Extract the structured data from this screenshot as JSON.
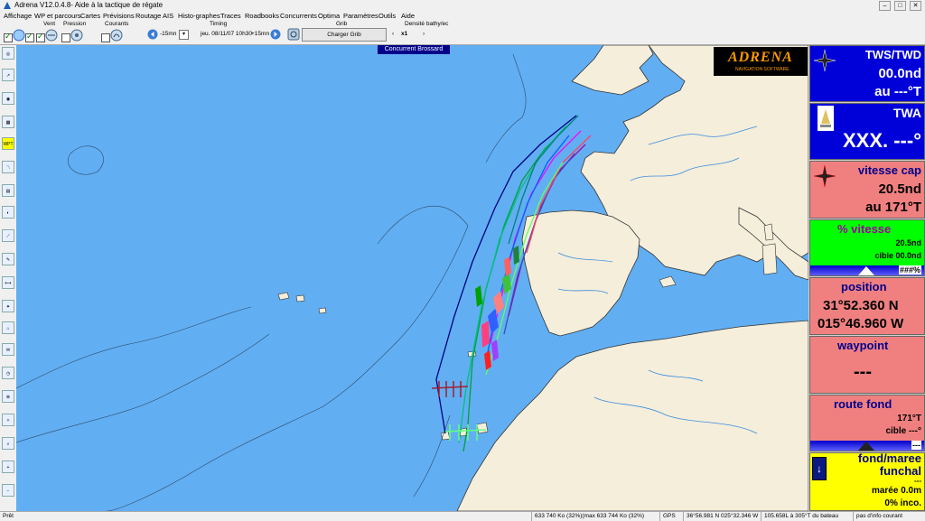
{
  "window": {
    "title": "Adrena V12.0.4.8- Aide à la tactique de régate"
  },
  "menu": [
    "Affichage",
    "WP et parcours",
    "Cartes",
    "Prévisions",
    "Routage",
    "AIS",
    "Histo-graphes",
    "Traces",
    "Roadbooks",
    "Concurrents",
    "Optima",
    "Paramètres",
    "Outils",
    "Aide"
  ],
  "toolbar": {
    "group_labels": {
      "vent": "Vent",
      "pression": "Pression",
      "courants": "Courants",
      "timing": "Timing",
      "grib": "Grib",
      "densite": "Densité bathy/ec"
    },
    "step_back": "-15mn",
    "date": "jeu. 08/11/07 10h30",
    "step_fwd": "+15mn",
    "load_grib": "Charger Grib",
    "speed": "x1"
  },
  "map": {
    "tooltip": "Concurrent Brossard",
    "logo": {
      "name": "ADRENA",
      "sub": "NAVIGATION SOFTWARE"
    },
    "colors": {
      "sea": "#62aef2",
      "land": "#f4eedb",
      "coast": "#333333",
      "river": "#3c8cdc"
    }
  },
  "panels": {
    "tws": {
      "label": "TWS/TWD",
      "value": "00.0nd",
      "sub": "au ---°T",
      "icon": "compass-rose"
    },
    "twa": {
      "label": "TWA",
      "value": "XXX. ---°",
      "icon": "sailboat"
    },
    "speed": {
      "label": "vitesse cap",
      "value": "20.5nd",
      "sub": "au 171°T",
      "icon": "compass-rose"
    },
    "pct": {
      "label": "% vitesse",
      "value": "20.5nd",
      "sub": "cible 00.0nd",
      "bar": "###%"
    },
    "position": {
      "label": "position",
      "lat": "31°52.360 N",
      "lon": "015°46.960 W"
    },
    "waypoint": {
      "label": "waypoint",
      "value": "---"
    },
    "route": {
      "label": "route fond",
      "value": "171°T",
      "sub": "cible ---°",
      "bar": "---"
    },
    "tide": {
      "label": "fond/maree",
      "place": "funchal",
      "extra": "---",
      "value": "marée 0.0m",
      "sub": "0% inco."
    }
  },
  "status": {
    "left": "Prêt",
    "mem": "633 740 Ko (32%)(max 633 744 Ko (32%)",
    "gps": "GPS",
    "coords": "36°56.981 N 025°32.346 W",
    "dist": "105.658L à 305°T du bateau",
    "info": "pas d'info courant"
  }
}
